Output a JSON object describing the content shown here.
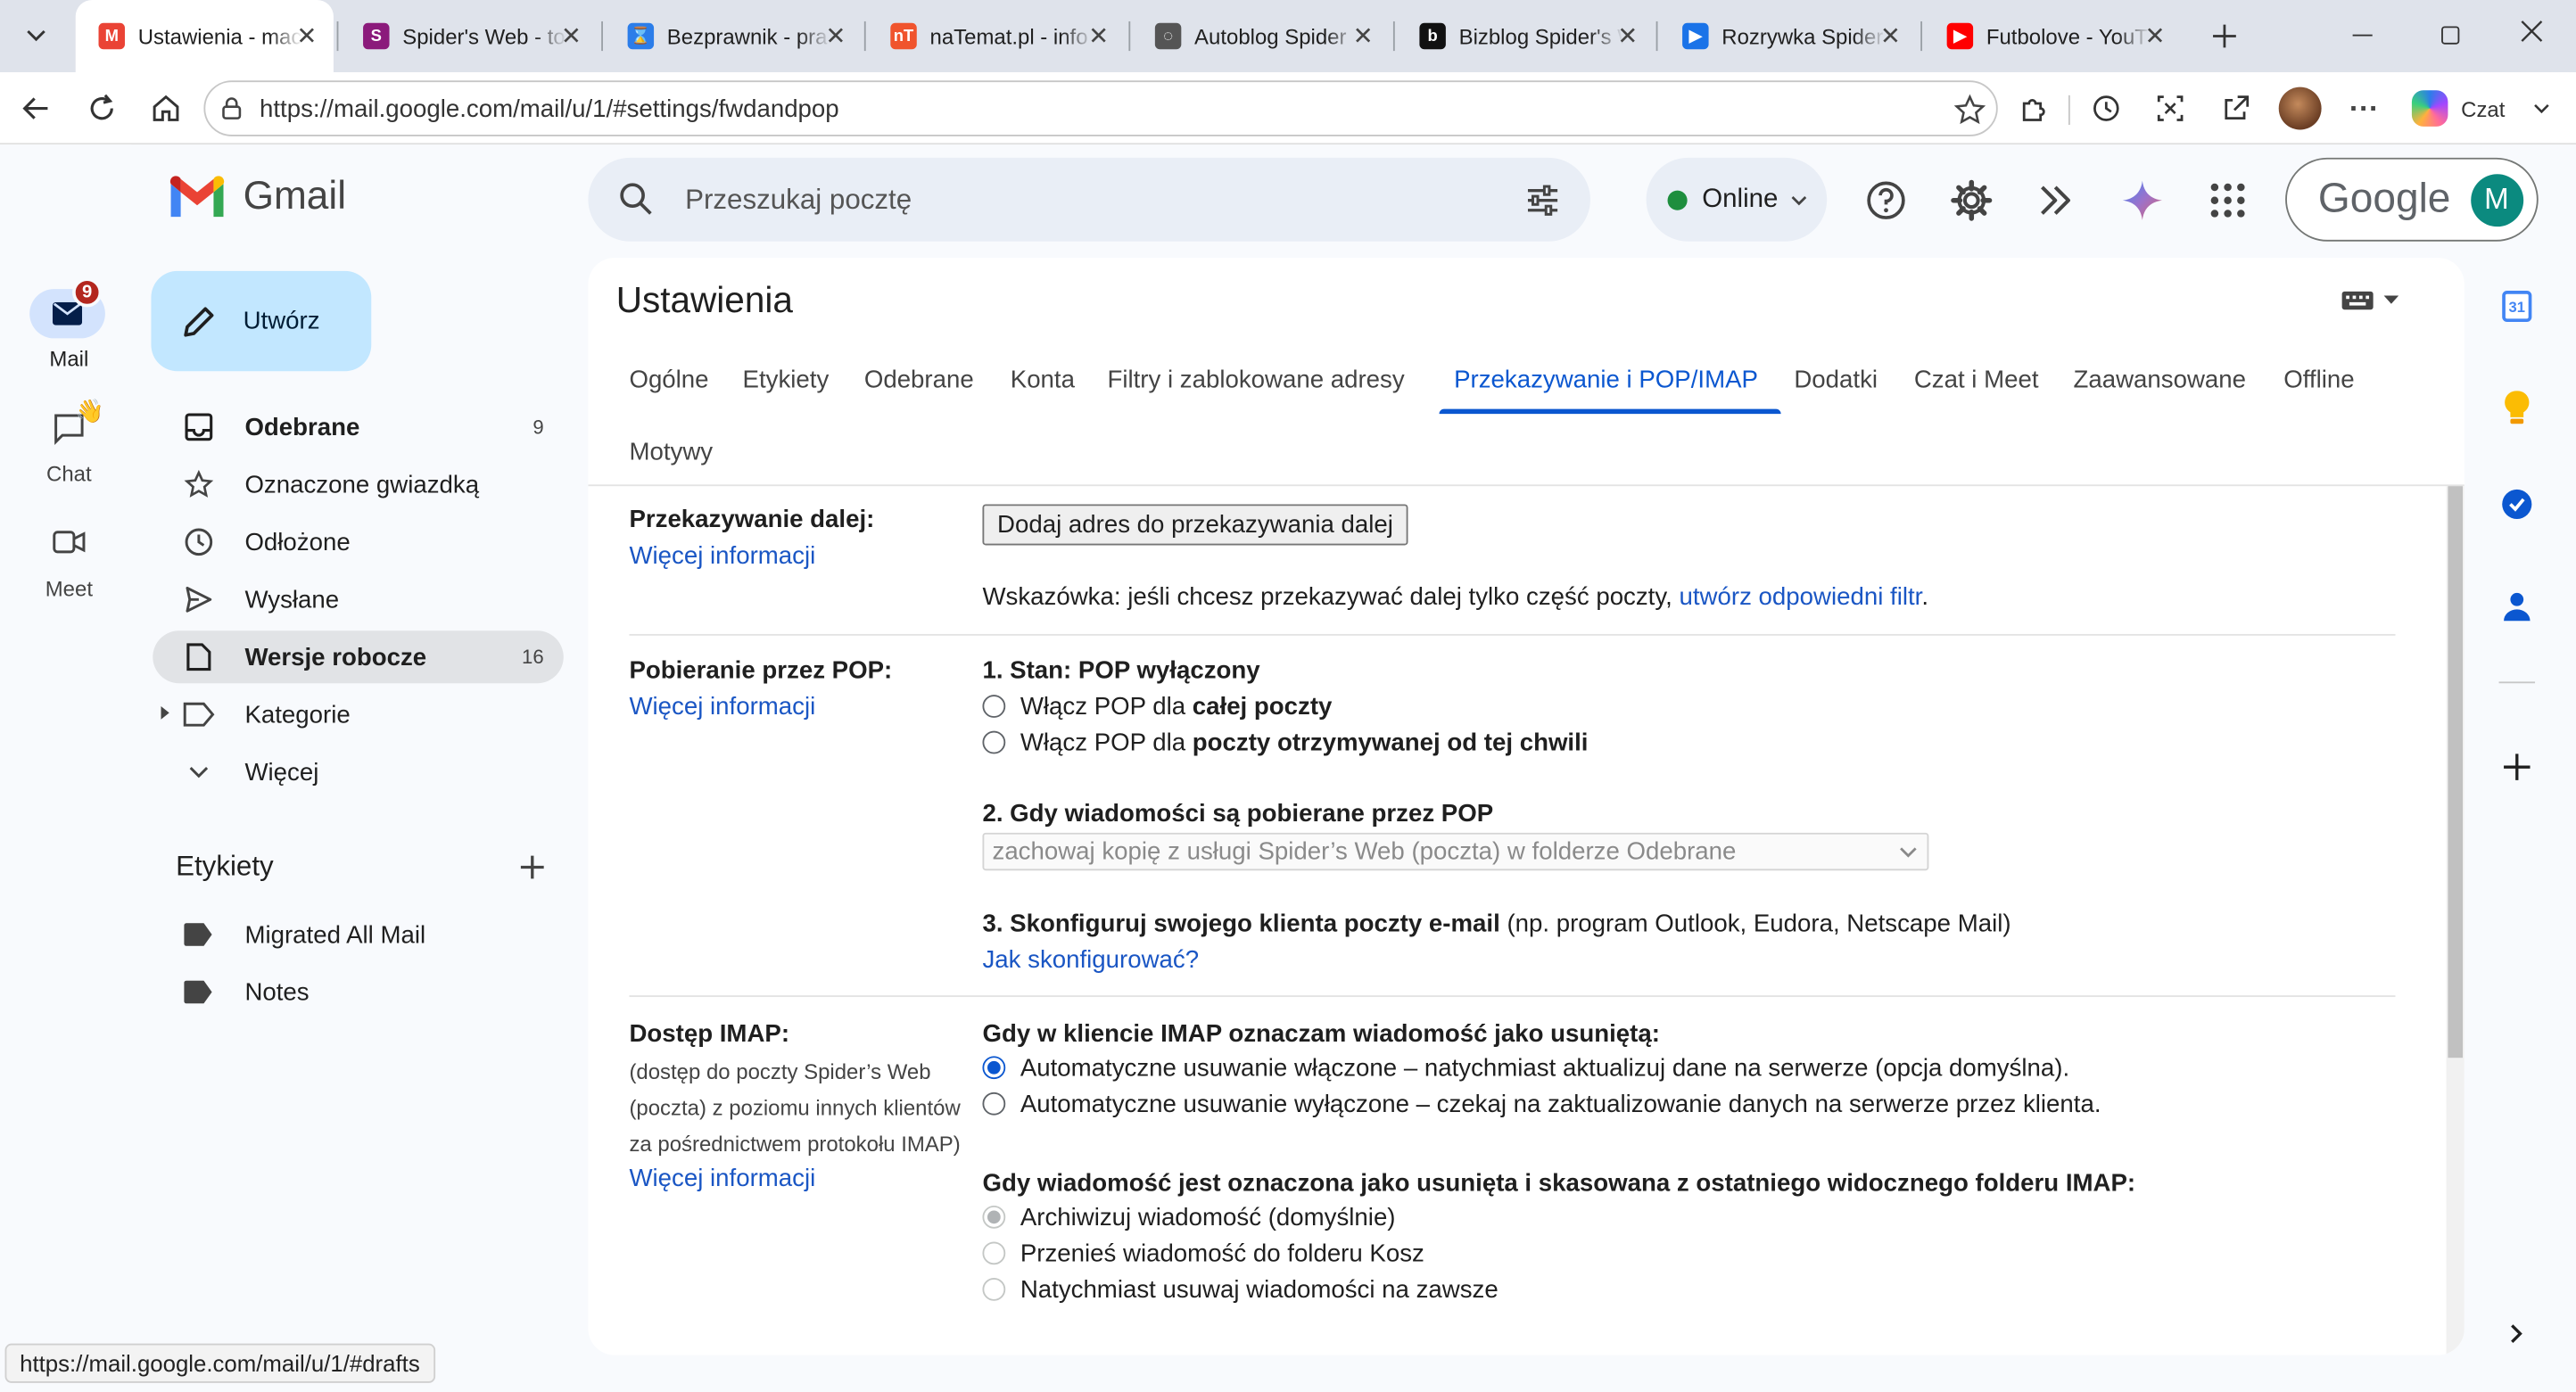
{
  "browser": {
    "tabs": [
      {
        "title": "Ustawienia - mac",
        "favicon": "M",
        "color": "#ea4335"
      },
      {
        "title": "Spider's Web - to",
        "favicon": "S",
        "color": "#8b1a7b"
      },
      {
        "title": "Bezprawnik - pra",
        "favicon": "⌛",
        "color": "#2b7de9"
      },
      {
        "title": "naTemat.pl - info",
        "favicon": "nT",
        "color": "#f0542d"
      },
      {
        "title": "Autoblog Spider",
        "favicon": "◌",
        "color": "#555555"
      },
      {
        "title": "Bizblog Spider's W",
        "favicon": "b",
        "color": "#111111"
      },
      {
        "title": "Rozrywka Spider",
        "favicon": "▶",
        "color": "#1a73e8"
      },
      {
        "title": "Futbolove - YouT",
        "favicon": "▶",
        "color": "#ff0000"
      }
    ],
    "url": "https://mail.google.com/mail/u/1/#settings/fwdandpop",
    "copilot_label": "Czat",
    "status_url": "https://mail.google.com/mail/u/1/#drafts"
  },
  "gmail": {
    "logo_text": "Gmail",
    "search_placeholder": "Przeszukaj pocztę",
    "status": "Online",
    "google_label": "Google",
    "avatar_letter": "M",
    "rail": [
      {
        "label": "Mail",
        "badge": "9"
      },
      {
        "label": "Chat"
      },
      {
        "label": "Meet"
      }
    ],
    "compose_label": "Utwórz",
    "nav": [
      {
        "label": "Odebrane",
        "count": "9"
      },
      {
        "label": "Oznaczone gwiazdką",
        "count": ""
      },
      {
        "label": "Odłożone",
        "count": ""
      },
      {
        "label": "Wysłane",
        "count": ""
      },
      {
        "label": "Wersje robocze",
        "count": "16"
      },
      {
        "label": "Kategorie",
        "count": ""
      },
      {
        "label": "Więcej",
        "count": ""
      }
    ],
    "labels_title": "Etykiety",
    "labels": [
      "Migrated All Mail",
      "Notes"
    ]
  },
  "settings": {
    "title": "Ustawienia",
    "tabs": [
      "Ogólne",
      "Etykiety",
      "Odebrane",
      "Konta",
      "Filtry i zablokowane adresy",
      "Przekazywanie i POP/IMAP",
      "Dodatki",
      "Czat i Meet",
      "Zaawansowane",
      "Offline",
      "Motywy"
    ],
    "forwarding": {
      "label": "Przekazywanie dalej:",
      "more": "Więcej informacji",
      "button": "Dodaj adres do przekazywania dalej",
      "hint": "Wskazówka: jeśli chcesz przekazywać dalej tylko część poczty,",
      "hint_link": "utwórz odpowiedni filtr",
      "hint_end": "."
    },
    "pop": {
      "label": "Pobieranie przez POP:",
      "more": "Więcej informacji",
      "status": "1. Stan: POP wyłączony",
      "opt1_prefix": "Włącz POP dla",
      "opt1_bold": "całej poczty",
      "opt2_prefix": "Włącz POP dla",
      "opt2_bold": "poczty otrzymywanej od tej chwili",
      "when_title": "2. Gdy wiadomości są pobierane przez POP",
      "when_select": "zachowaj kopię z usługi Spider’s Web (poczta) w folderze Odebrane",
      "config_title": "3. Skonfiguruj swojego klienta poczty e-mail",
      "config_note": "(np. program Outlook, Eudora, Netscape Mail)",
      "config_link": "Jak skonfigurować?"
    },
    "imap": {
      "label": "Dostęp IMAP:",
      "desc": [
        "(dostęp do poczty Spider’s Web",
        "(poczta) z poziomu innych klientów",
        "za pośrednictwem protokołu IMAP)"
      ],
      "more": "Więcej informacji",
      "deleted_title": "Gdy w kliencie IMAP oznaczam wiadomość jako usuniętą:",
      "deleted_opt1": "Automatyczne usuwanie włączone – natychmiast aktualizuj dane na serwerze (opcja domyślna).",
      "deleted_opt2": "Automatyczne usuwanie wyłączone – czekaj na zaktualizowanie danych na serwerze przez klienta.",
      "expunge_title": "Gdy wiadomość jest oznaczona jako usunięta i skasowana z ostatniego widocznego folderu IMAP:",
      "expunge_opt1": "Archiwizuj wiadomość (domyślnie)",
      "expunge_opt2": "Przenieś wiadomość do folderu Kosz",
      "expunge_opt3": "Natychmiast usuwaj wiadomości na zawsze"
    }
  },
  "side_panel": {
    "calendar_day": "31"
  }
}
